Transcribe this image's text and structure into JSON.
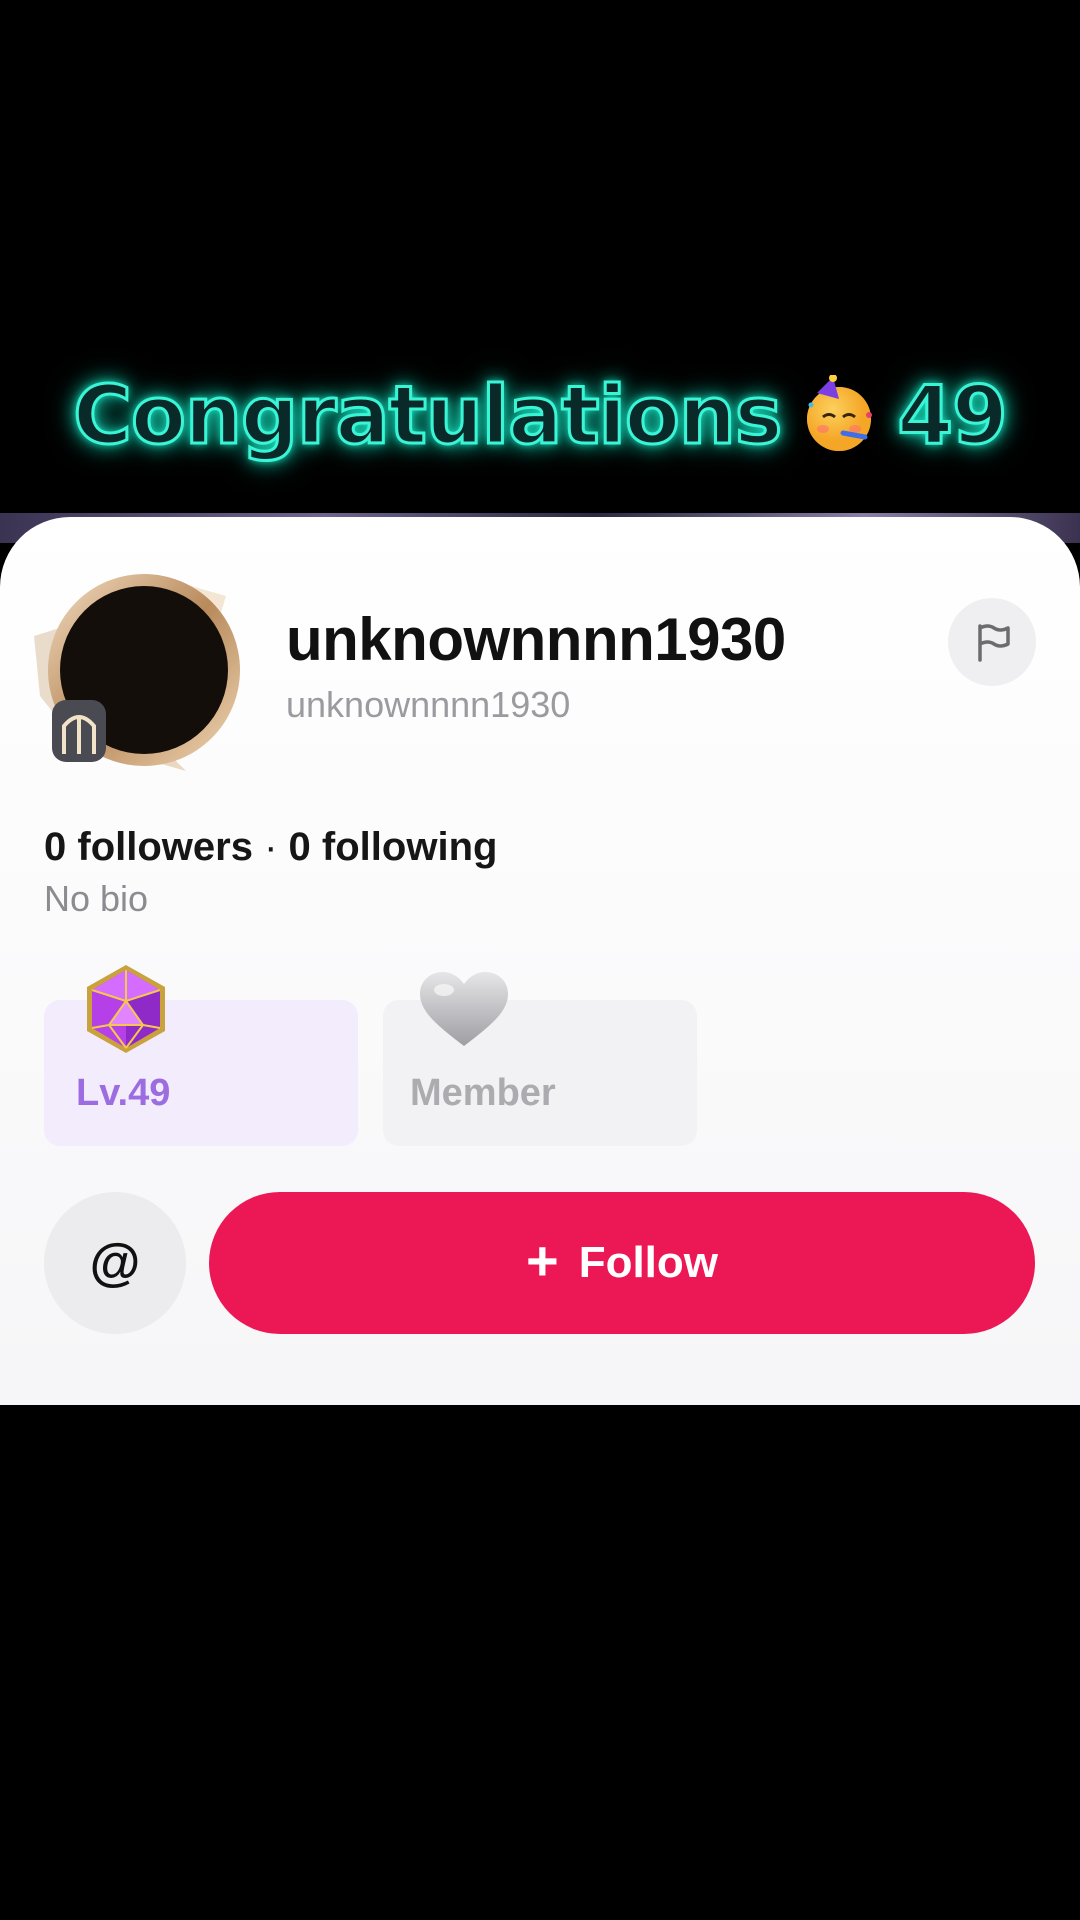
{
  "banner": {
    "text": "Congratulations",
    "number": "49",
    "emoji": "partying-face"
  },
  "profile": {
    "display_name": "unknownnnn1930",
    "username": "unknownnnn1930",
    "followers_count": "0",
    "followers_label": "followers",
    "separator": "·",
    "following_count": "0",
    "following_label": "following",
    "bio": "No bio"
  },
  "badges": {
    "level_label": "Lv.49",
    "member_label": "Member"
  },
  "actions": {
    "mention_label": "@",
    "follow_plus": "+",
    "follow_label": "Follow"
  },
  "colors": {
    "accent": "#ec1856",
    "level": "#9b6de0",
    "glow": "#39f5d6"
  }
}
